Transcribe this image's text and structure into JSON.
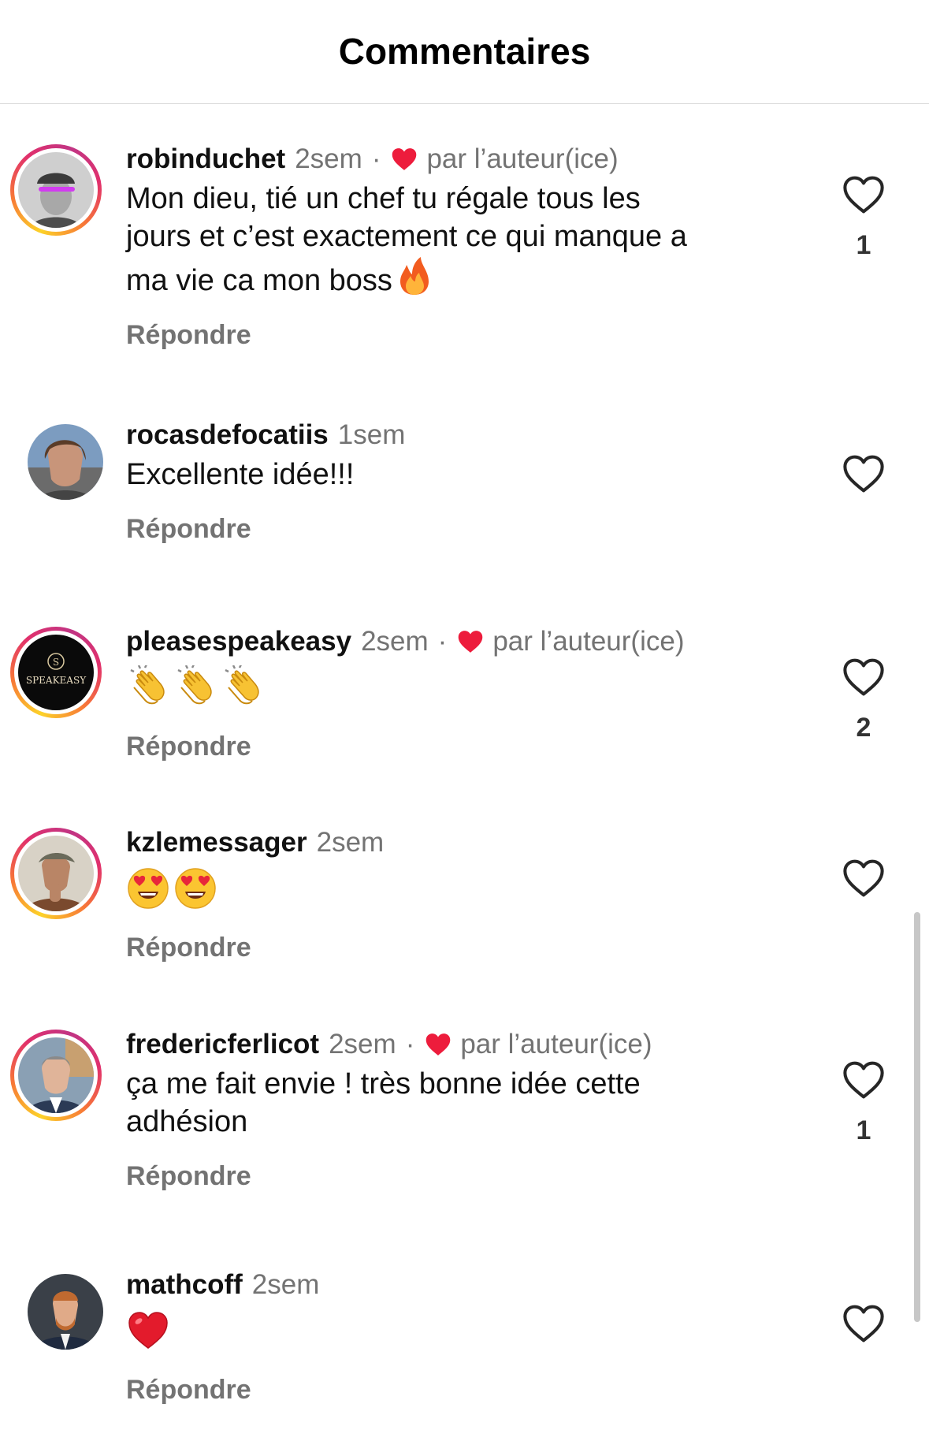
{
  "header": {
    "title": "Commentaires"
  },
  "labels": {
    "reply": "Répondre",
    "by_author": "par l’auteur(ice)"
  },
  "colors": {
    "accent_heart": "#ed1c3c",
    "muted": "#737373"
  },
  "comments": [
    {
      "username": "robinduchet",
      "time": "2sem",
      "liked_by_author": true,
      "text": "Mon dieu, tié un chef tu régale tous les\njours et c’est exactement ce qui manque a\nma vie ca mon boss",
      "trailing_emoji": "fire",
      "likes": "1",
      "has_story_ring": true
    },
    {
      "username": "rocasdefocatiis",
      "time": "1sem",
      "liked_by_author": false,
      "text": "Excellente idée!!!",
      "likes": "",
      "has_story_ring": false
    },
    {
      "username": "pleasespeakeasy",
      "time": "2sem",
      "liked_by_author": true,
      "emojis": [
        "clapping-hands",
        "clapping-hands",
        "clapping-hands"
      ],
      "likes": "2",
      "has_story_ring": true,
      "avatar_text": "SPEAKEASY",
      "avatar_letter": "S"
    },
    {
      "username": "kzlemessager",
      "time": "2sem",
      "liked_by_author": false,
      "emojis": [
        "heart-eyes",
        "heart-eyes"
      ],
      "likes": "",
      "has_story_ring": true
    },
    {
      "username": "fredericferlicot",
      "time": "2sem",
      "liked_by_author": true,
      "text": "ça me fait envie ! très bonne idée cette\nadhésion",
      "likes": "1",
      "has_story_ring": true
    },
    {
      "username": "mathcoff",
      "time": "2sem",
      "liked_by_author": false,
      "emojis": [
        "red-heart"
      ],
      "likes": "",
      "has_story_ring": false
    }
  ]
}
